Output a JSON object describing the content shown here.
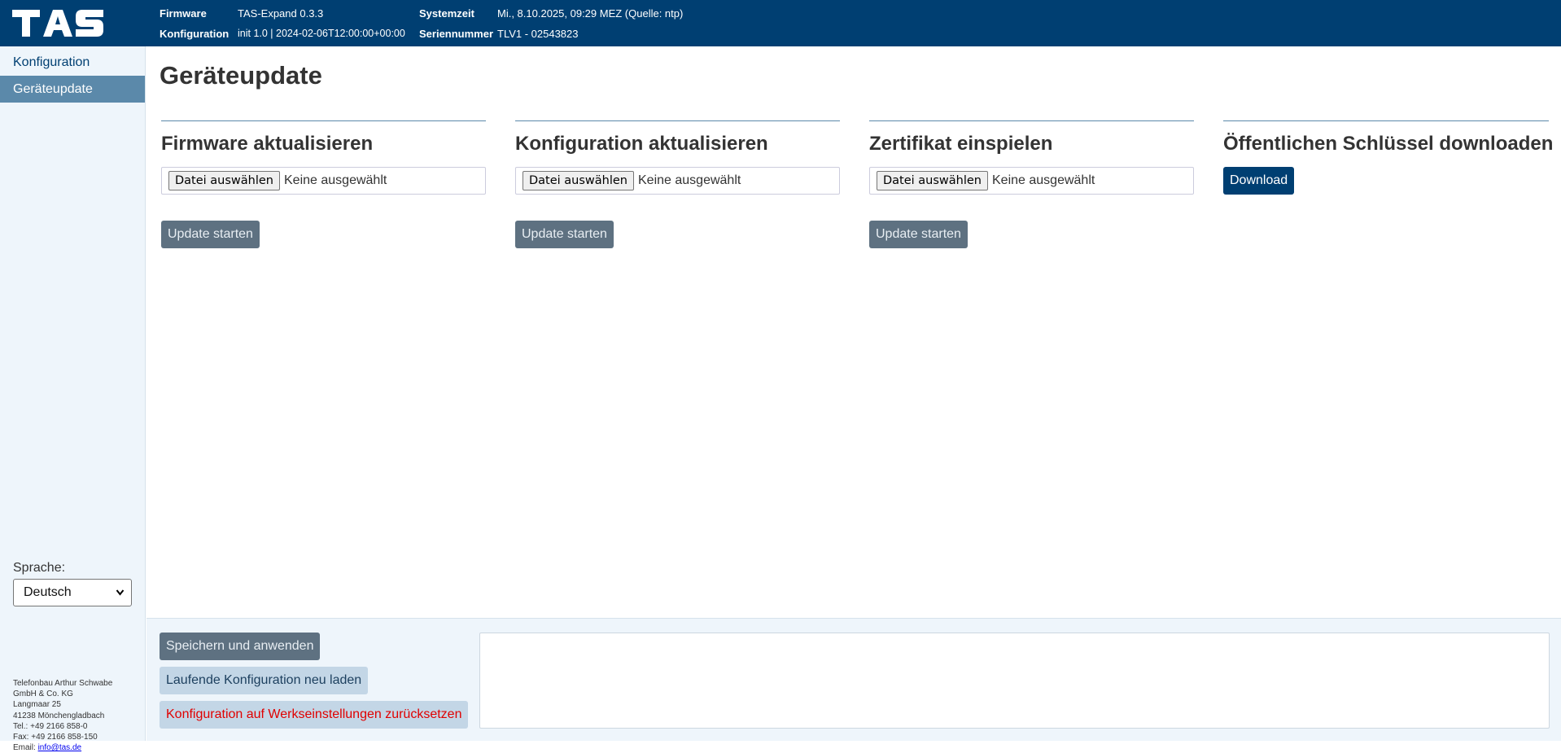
{
  "header": {
    "logo_text": "TAS",
    "firmware_label": "Firmware",
    "firmware_value": "TAS-Expand 0.3.3",
    "config_label": "Konfiguration",
    "config_value": "init 1.0 | 2024-02-06T12:00:00+00:00",
    "time_label": "Systemzeit",
    "time_value": "Mi., 8.10.2025, 09:29 MEZ (Quelle: ntp)",
    "serial_label": "Seriennummer",
    "serial_value": "TLV1 - 02543823"
  },
  "sidebar": {
    "items": [
      {
        "label": "Konfiguration",
        "active": false
      },
      {
        "label": "Geräteupdate",
        "active": true
      }
    ],
    "language_label": "Sprache:",
    "language_selected": "Deutsch",
    "company": {
      "line1": "Telefonbau Arthur Schwabe",
      "line2": "GmbH & Co. KG",
      "line3": "Langmaar 25",
      "line4": "41238 Mönchengladbach",
      "phone": "Tel.: +49 2166 858-0",
      "fax": "Fax: +49 2166 858-150",
      "email_label": "Email: ",
      "email": "info@tas.de"
    }
  },
  "main": {
    "title": "Geräteupdate",
    "panels": [
      {
        "title": "Firmware aktualisieren",
        "file_button": "Datei auswählen",
        "file_status": "Keine ausgewählt",
        "action": "Update starten"
      },
      {
        "title": "Konfiguration aktualisieren",
        "file_button": "Datei auswählen",
        "file_status": "Keine ausgewählt",
        "action": "Update starten"
      },
      {
        "title": "Zertifikat einspielen",
        "file_button": "Datei auswählen",
        "file_status": "Keine ausgewählt",
        "action": "Update starten"
      },
      {
        "title": "Öffentlichen Schlüssel downloaden",
        "action": "Download"
      }
    ]
  },
  "footer": {
    "save_label": "Speichern und anwenden",
    "reload_label": "Laufende Konfiguration neu laden",
    "reset_label": "Konfiguration auf Werkseinstellungen zurücksetzen"
  },
  "colors": {
    "brand": "#003f72",
    "accent": "#5b89aa",
    "danger": "#e00000"
  }
}
